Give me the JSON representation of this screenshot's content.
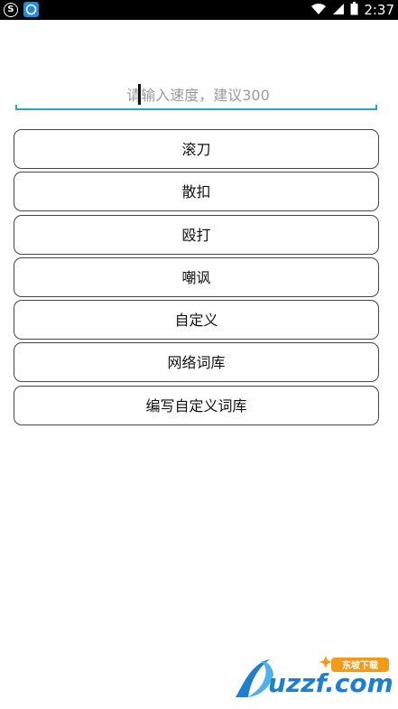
{
  "status_bar": {
    "time": "2:37",
    "left_icons": [
      "sogou-icon",
      "app-icon"
    ],
    "right_icons": [
      "wifi-icon",
      "signal-icon",
      "battery-icon"
    ],
    "sogou_glyph": "S"
  },
  "speed_input": {
    "placeholder": "请输入速度，建议300",
    "value": ""
  },
  "buttons": [
    {
      "label": "滚刀"
    },
    {
      "label": "散扣"
    },
    {
      "label": "殴打"
    },
    {
      "label": "嘲讽"
    },
    {
      "label": "自定义"
    },
    {
      "label": "网络词库"
    },
    {
      "label": "编写自定义词库"
    }
  ],
  "watermark": {
    "logo_text": "uzzf.com",
    "tag_text": "东坡下载"
  },
  "colors": {
    "accent": "#2aa2c9",
    "status_bar": "#000000",
    "watermark_blue": "#1e7fd0",
    "watermark_orange": "#f29a1a"
  }
}
